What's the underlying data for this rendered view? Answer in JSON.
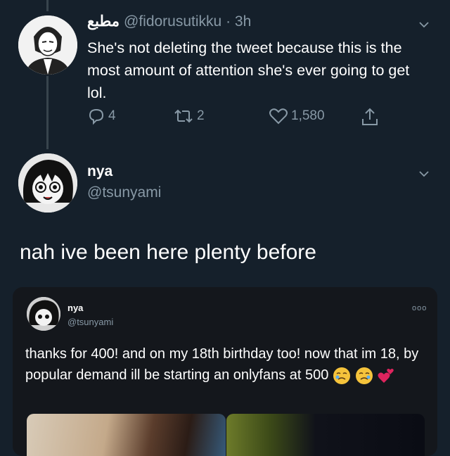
{
  "tweet1": {
    "display_name": "مطبع",
    "handle": "@fidorusutikku",
    "separator": "·",
    "time": "3h",
    "text": "She's not deleting the tweet because this is the most amount of attention she's ever going to get lol.",
    "replies": "4",
    "retweets": "2",
    "likes": "1,580",
    "icons": {
      "reply": "reply-icon",
      "retweet": "retweet-icon",
      "like": "heart-icon",
      "share": "share-icon",
      "menu": "chevron-down-icon"
    }
  },
  "tweet2": {
    "display_name": "nya",
    "handle": "@tsunyami",
    "text": "nah ive been here plenty before"
  },
  "quoted": {
    "display_name": "nya",
    "handle": "@tsunyami",
    "more": "ooo",
    "text": "thanks for 400! and on my 18th birthday too! now that im 18, by popular demand ill be starting an onlyfans at 500"
  },
  "colors": {
    "background": "#15202b",
    "secondary_text": "#8899a6",
    "quote_card": "#14171c",
    "heart_emoji": "#e0245e"
  }
}
